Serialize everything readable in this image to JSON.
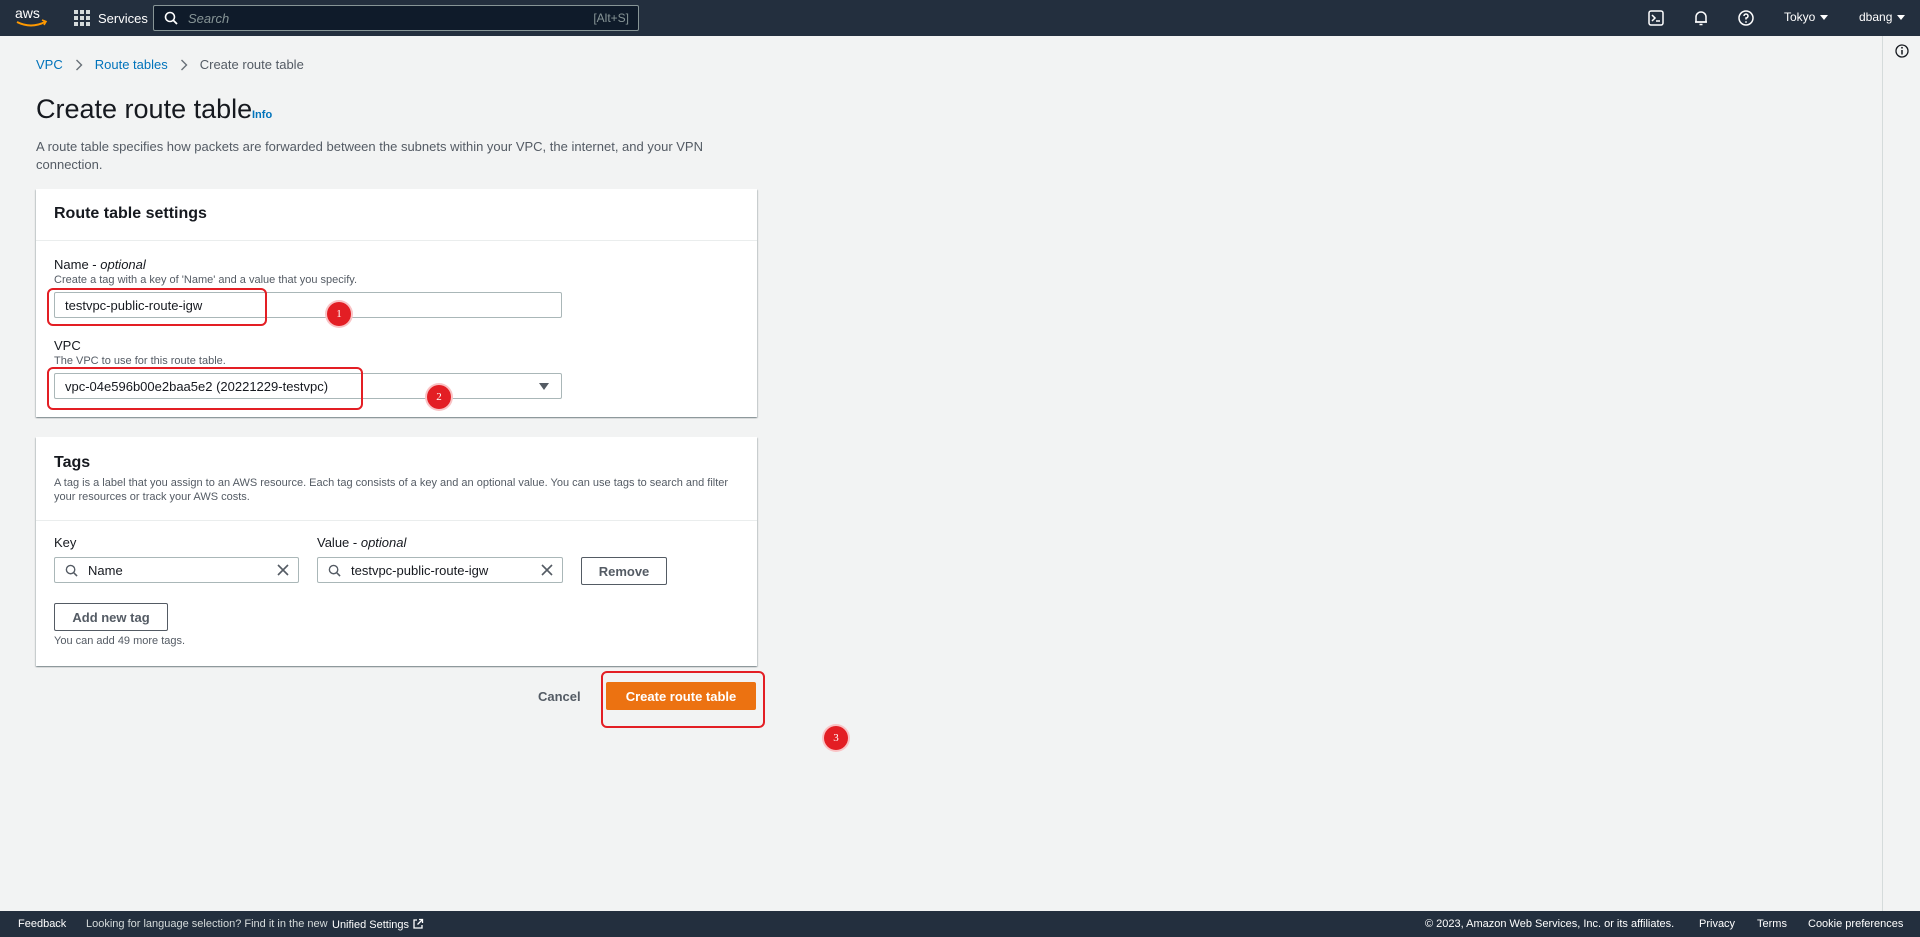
{
  "topbar": {
    "services_label": "Services",
    "search_placeholder": "Search",
    "search_shortcut": "[Alt+S]",
    "region": "Tokyo",
    "user": "dbang"
  },
  "breadcrumb": {
    "items": [
      "VPC",
      "Route tables"
    ],
    "current": "Create route table"
  },
  "page": {
    "title": "Create route table",
    "info": "Info",
    "description": "A route table specifies how packets are forwarded between the subnets within your VPC, the internet, and your VPN connection."
  },
  "settings": {
    "heading": "Route table settings",
    "name_label": "Name - ",
    "name_optional": "optional",
    "name_hint": "Create a tag with a key of 'Name' and a value that you specify.",
    "name_value": "testvpc-public-route-igw",
    "vpc_label": "VPC",
    "vpc_hint": "The VPC to use for this route table.",
    "vpc_value": "vpc-04e596b00e2baa5e2 (20221229-testvpc)"
  },
  "tags": {
    "heading": "Tags",
    "description": "A tag is a label that you assign to an AWS resource. Each tag consists of a key and an optional value. You can use tags to search and filter your resources or track your AWS costs.",
    "key_label": "Key",
    "value_label": "Value - ",
    "value_optional": "optional",
    "rows": [
      {
        "key": "Name",
        "value": "testvpc-public-route-igw"
      }
    ],
    "remove_label": "Remove",
    "add_label": "Add new tag",
    "limit_text": "You can add 49 more tags."
  },
  "actions": {
    "cancel": "Cancel",
    "submit": "Create route table"
  },
  "annotations": [
    "1",
    "2",
    "3"
  ],
  "footer": {
    "feedback": "Feedback",
    "language_text": "Looking for language selection? Find it in the new",
    "unified_settings": "Unified Settings",
    "copyright": "© 2023, Amazon Web Services, Inc. or its affiliates.",
    "privacy": "Privacy",
    "terms": "Terms",
    "cookies": "Cookie preferences"
  },
  "colors": {
    "nav_bg": "#232f3e",
    "primary": "#ec7211",
    "link": "#0073bb",
    "annotation": "#e31e24"
  }
}
